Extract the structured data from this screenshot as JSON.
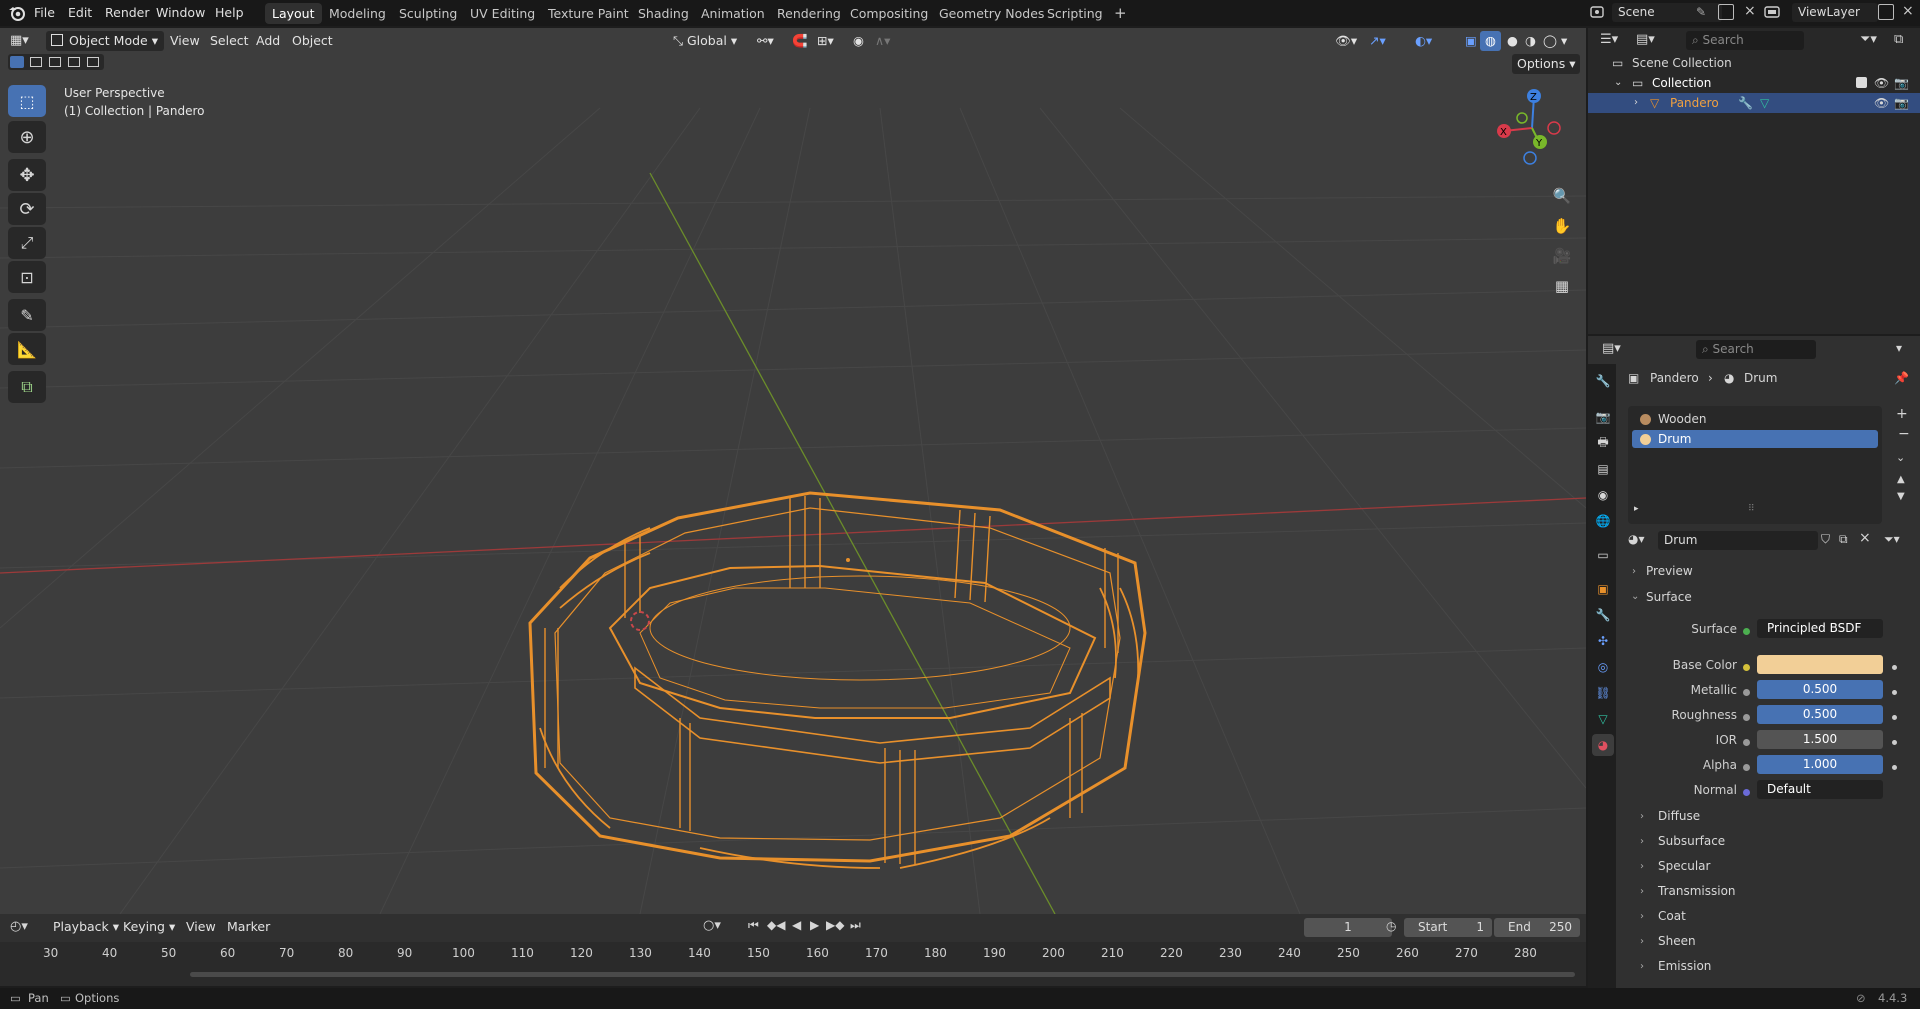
{
  "topbar": {
    "menus": [
      "File",
      "Edit",
      "Render",
      "Window",
      "Help"
    ],
    "workspaces": [
      "Layout",
      "Modeling",
      "Sculpting",
      "UV Editing",
      "Texture Paint",
      "Shading",
      "Animation",
      "Rendering",
      "Compositing",
      "Geometry Nodes",
      "Scripting"
    ],
    "add_tab": "+",
    "scene": "Scene",
    "view_layer": "ViewLayer"
  },
  "viewport": {
    "mode": "Object Mode",
    "menus": [
      "View",
      "Select",
      "Add",
      "Object"
    ],
    "orientation": "Global",
    "options": "Options",
    "overlay_line1": "User Perspective",
    "overlay_line2": "(1) Collection | Pandero",
    "gizmo_axes": {
      "x": "X",
      "y": "Y",
      "z": "Z"
    },
    "wire_color": "#e8902b"
  },
  "outliner": {
    "search_placeholder": "Search",
    "scene_collection": "Scene Collection",
    "collection": "Collection",
    "object": "Pandero"
  },
  "properties": {
    "search_placeholder": "Search",
    "breadcrumb_object": "Pandero",
    "breadcrumb_material": "Drum",
    "slots": [
      "Wooden",
      "Drum"
    ],
    "active_material": "Drum",
    "preview_label": "Preview",
    "surface_section": "Surface",
    "rows": {
      "surface": {
        "label": "Surface",
        "value": "Principled BSDF"
      },
      "base_color": {
        "label": "Base Color",
        "color": "#f2cf97"
      },
      "metallic": {
        "label": "Metallic",
        "value": "0.500"
      },
      "roughness": {
        "label": "Roughness",
        "value": "0.500"
      },
      "ior": {
        "label": "IOR",
        "value": "1.500"
      },
      "alpha": {
        "label": "Alpha",
        "value": "1.000"
      },
      "normal": {
        "label": "Normal",
        "value": "Default"
      }
    },
    "subsections": [
      "Diffuse",
      "Subsurface",
      "Specular",
      "Transmission",
      "Coat",
      "Sheen",
      "Emission"
    ]
  },
  "timeline": {
    "menus": [
      "Playback",
      "Keying",
      "View",
      "Marker"
    ],
    "current_frame": "1",
    "start_label": "Start",
    "start": "1",
    "end_label": "End",
    "end": "250",
    "ruler": [
      "30",
      "40",
      "50",
      "60",
      "70",
      "80",
      "90",
      "100",
      "110",
      "120",
      "130",
      "140",
      "150",
      "160",
      "170",
      "180",
      "190",
      "200",
      "210",
      "220",
      "230",
      "240",
      "250",
      "260",
      "270",
      "280"
    ]
  },
  "statusbar": {
    "left1": "Pan",
    "left2": "Options",
    "version": "4.4.3"
  }
}
